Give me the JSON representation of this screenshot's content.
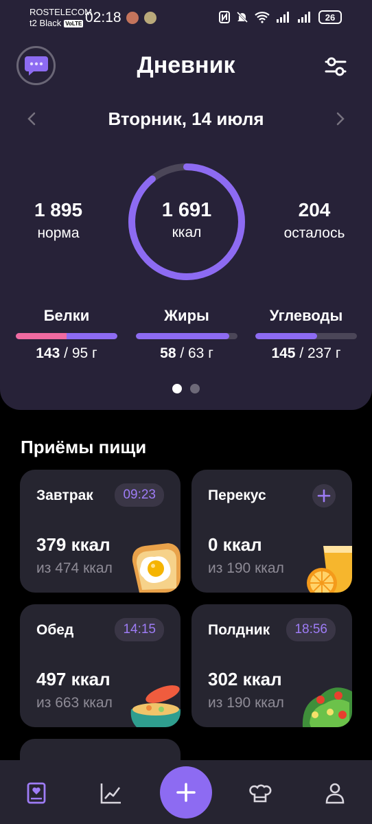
{
  "status_bar": {
    "carrier": "ROSTELECOM",
    "carrier2": "t2 Black",
    "volte": "VoLTE",
    "time": "02:18",
    "battery": "26"
  },
  "header": {
    "title": "Дневник",
    "date": "Вторник,  14 июля"
  },
  "summary": {
    "norma_value": "1 895",
    "norma_label": "норма",
    "eaten_value": "1 691",
    "eaten_unit": "ккал",
    "left_value": "204",
    "left_label": "осталось",
    "ring_fraction": 0.892
  },
  "macros": [
    {
      "name": "Белки",
      "current": "143",
      "rest": " / 95 г",
      "fraction": 1.0,
      "over_fraction": 0.5
    },
    {
      "name": "Жиры",
      "current": "58",
      "rest": " / 63 г",
      "fraction": 0.92
    },
    {
      "name": "Углеводы",
      "current": "145",
      "rest": " / 237 г",
      "fraction": 0.61
    }
  ],
  "pager": {
    "pages": 2,
    "active": 0
  },
  "meals_section": {
    "title": "Приёмы пищи"
  },
  "meals": [
    {
      "name": "Завтрак",
      "time": "09:23",
      "kcal": "379 ккал",
      "target": "из 474 ккал"
    },
    {
      "name": "Перекус",
      "time": "",
      "kcal": "0 ккал",
      "target": "из 190 ккал"
    },
    {
      "name": "Обед",
      "time": "14:15",
      "kcal": "497 ккал",
      "target": "из 663 ккал"
    },
    {
      "name": "Полдник",
      "time": "18:56",
      "kcal": "302 ккал",
      "target": "из 190 ккал"
    }
  ],
  "colors": {
    "accent": "#8d6bf2",
    "over": "#f06aa0",
    "panel": "#272238",
    "card": "#262530"
  },
  "nav": {
    "items": [
      "diary-icon",
      "stats-icon",
      "add-icon",
      "recipes-icon",
      "profile-icon"
    ],
    "active": "diary-icon"
  }
}
